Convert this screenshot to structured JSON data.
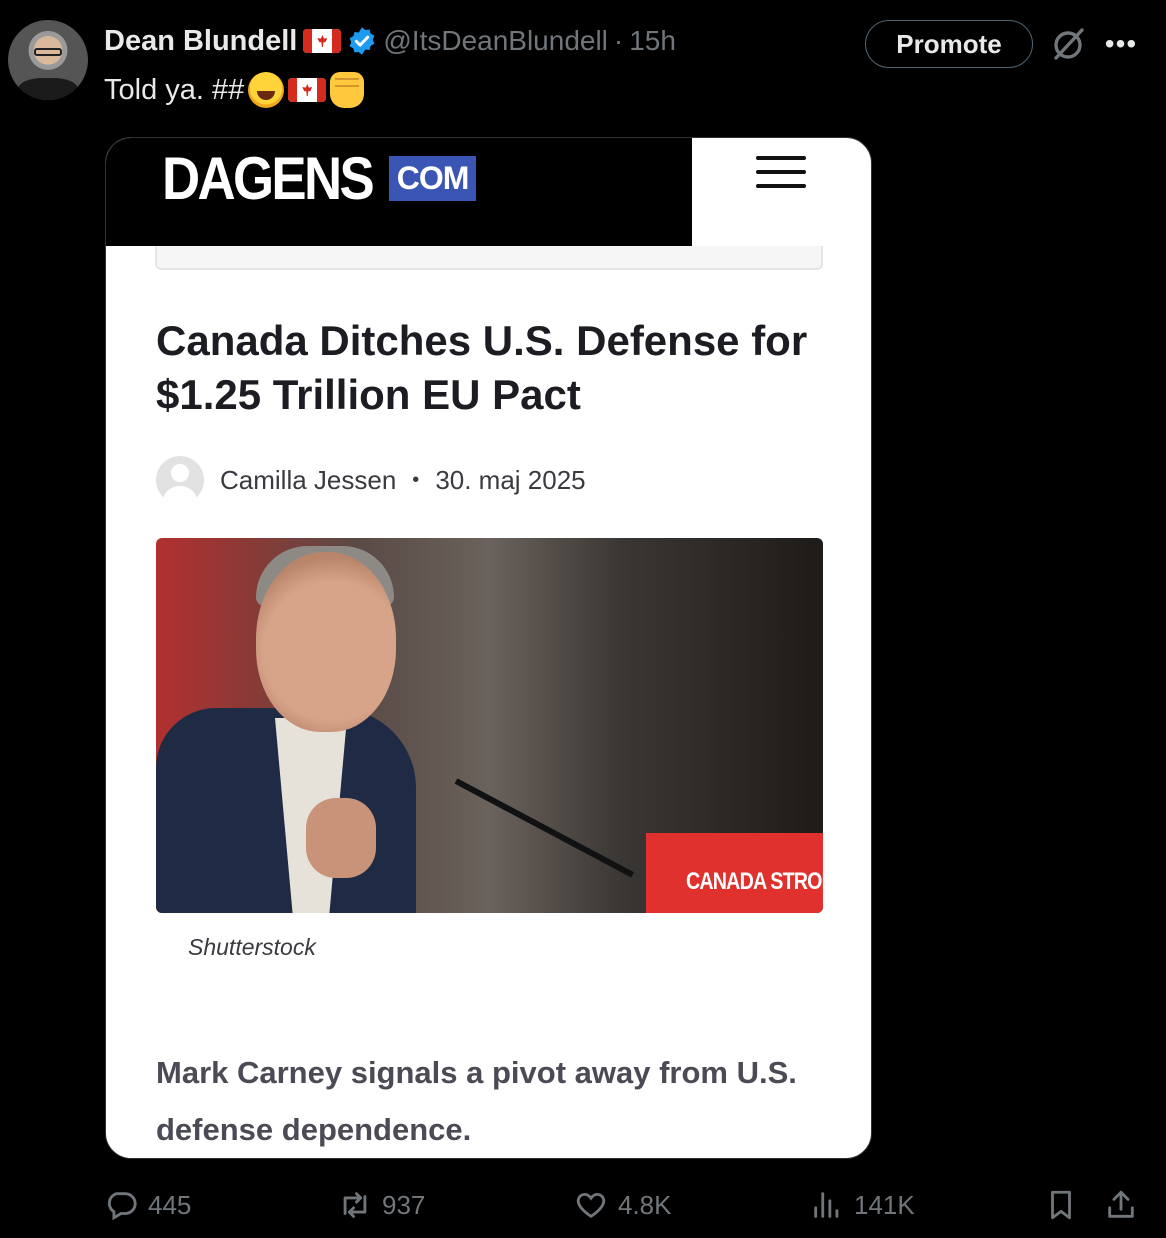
{
  "tweet": {
    "display_name": "Dean Blundell",
    "handle": "@ItsDeanBlundell",
    "separator": "·",
    "time": "15h",
    "text": "Told ya. ##",
    "promote_label": "Promote"
  },
  "card": {
    "logo_primary": "DAGENS",
    "logo_secondary": "COM",
    "headline": "Canada Ditches U.S. Defense for $1.25 Trillion EU Pact",
    "author": "Camilla Jessen",
    "author_separator": "•",
    "date": "30. maj 2025",
    "photo_sign_text": "CANADA STRONG",
    "photo_credit": "Shutterstock",
    "lede": "Mark Carney signals a pivot away from U.S. defense dependence."
  },
  "metrics": {
    "replies": "445",
    "reposts": "937",
    "likes": "4.8K",
    "views": "141K"
  },
  "colors": {
    "background": "#000000",
    "muted_text": "#71767b",
    "verified_blue": "#1d9bf0",
    "dagens_blue": "#3a55b4",
    "canada_red": "#d52b1e"
  },
  "icons": [
    "verified-badge-icon",
    "grok-icon",
    "more-icon",
    "reply-icon",
    "repost-icon",
    "like-icon",
    "views-icon",
    "bookmark-icon",
    "share-icon",
    "hamburger-menu-icon"
  ]
}
